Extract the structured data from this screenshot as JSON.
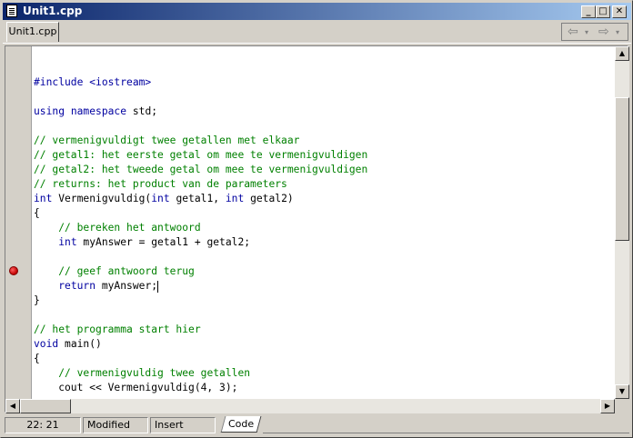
{
  "window": {
    "title": "Unit1.cpp",
    "controls": {
      "minimize": "_",
      "maximize": "□",
      "close": "✕"
    }
  },
  "tabs": [
    {
      "label": "Unit1.cpp",
      "active": true
    }
  ],
  "nav": {
    "back": "⇦",
    "forward": "⇨",
    "dropdown": "▾"
  },
  "editor": {
    "lines": [
      {
        "segments": []
      },
      {
        "segments": [
          {
            "cls": "pp",
            "text": "#include <iostream>"
          }
        ]
      },
      {
        "segments": []
      },
      {
        "segments": [
          {
            "cls": "kw",
            "text": "using"
          },
          {
            "cls": "",
            "text": " "
          },
          {
            "cls": "kw",
            "text": "namespace"
          },
          {
            "cls": "",
            "text": " std;"
          }
        ]
      },
      {
        "segments": []
      },
      {
        "segments": [
          {
            "cls": "cm",
            "text": "// vermenigvuldigt twee getallen met elkaar"
          }
        ]
      },
      {
        "segments": [
          {
            "cls": "cm",
            "text": "// getal1: het eerste getal om mee te vermenigvuldigen"
          }
        ]
      },
      {
        "segments": [
          {
            "cls": "cm",
            "text": "// getal2: het tweede getal om mee te vermenigvuldigen"
          }
        ]
      },
      {
        "segments": [
          {
            "cls": "cm",
            "text": "// returns: het product van de parameters"
          }
        ]
      },
      {
        "segments": [
          {
            "cls": "kw",
            "text": "int"
          },
          {
            "cls": "",
            "text": " Vermenigvuldig("
          },
          {
            "cls": "kw",
            "text": "int"
          },
          {
            "cls": "",
            "text": " getal1, "
          },
          {
            "cls": "kw",
            "text": "int"
          },
          {
            "cls": "",
            "text": " getal2)"
          }
        ]
      },
      {
        "segments": [
          {
            "cls": "",
            "text": "{"
          }
        ]
      },
      {
        "segments": [
          {
            "cls": "",
            "text": "    "
          },
          {
            "cls": "cm",
            "text": "// bereken het antwoord"
          }
        ]
      },
      {
        "segments": [
          {
            "cls": "",
            "text": "    "
          },
          {
            "cls": "kw",
            "text": "int"
          },
          {
            "cls": "",
            "text": " myAnswer = getal1 + getal2;"
          }
        ]
      },
      {
        "segments": []
      },
      {
        "segments": [
          {
            "cls": "",
            "text": "    "
          },
          {
            "cls": "cm",
            "text": "// geef antwoord terug"
          }
        ]
      },
      {
        "segments": [
          {
            "cls": "",
            "text": "    "
          },
          {
            "cls": "kw",
            "text": "return"
          },
          {
            "cls": "",
            "text": " myAnswer;"
          }
        ],
        "caret": true
      },
      {
        "segments": [
          {
            "cls": "",
            "text": "}"
          }
        ]
      },
      {
        "segments": []
      },
      {
        "segments": [
          {
            "cls": "cm",
            "text": "// het programma start hier"
          }
        ]
      },
      {
        "segments": [
          {
            "cls": "kw",
            "text": "void"
          },
          {
            "cls": "",
            "text": " main()"
          }
        ]
      },
      {
        "segments": [
          {
            "cls": "",
            "text": "{"
          }
        ]
      },
      {
        "segments": [
          {
            "cls": "",
            "text": "    "
          },
          {
            "cls": "cm",
            "text": "// vermenigvuldig twee getallen"
          }
        ]
      },
      {
        "segments": [
          {
            "cls": "",
            "text": "    cout << Vermenigvuldig(4, 3);"
          }
        ]
      },
      {
        "segments": [
          {
            "cls": "",
            "text": "}"
          }
        ]
      }
    ],
    "breakpoint_line": 16,
    "colors": {
      "keyword": "#0000a0",
      "comment": "#008000",
      "breakpoint": "#c00000"
    }
  },
  "status": {
    "position": "22: 21",
    "modified": "Modified",
    "mode": "Insert",
    "view_tab": "Code"
  }
}
